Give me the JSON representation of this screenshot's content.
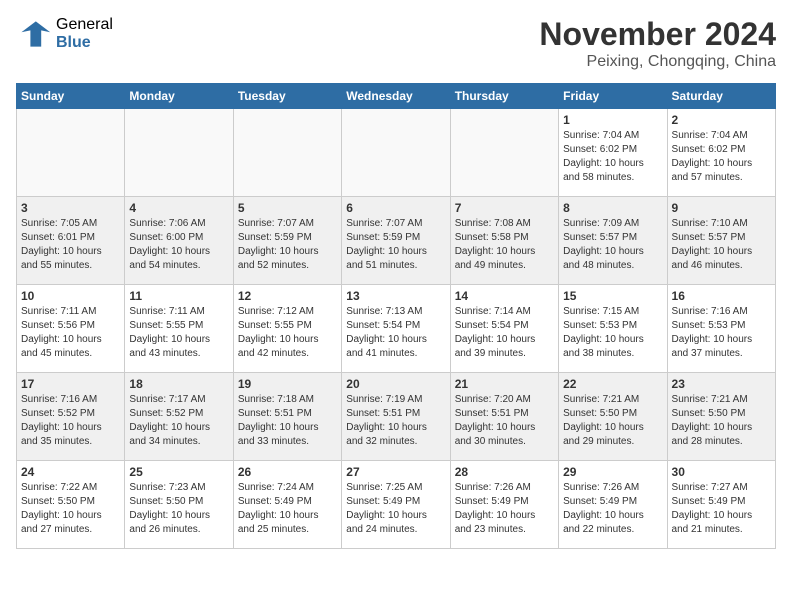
{
  "header": {
    "logo_general": "General",
    "logo_blue": "Blue",
    "month_title": "November 2024",
    "location": "Peixing, Chongqing, China"
  },
  "weekdays": [
    "Sunday",
    "Monday",
    "Tuesday",
    "Wednesday",
    "Thursday",
    "Friday",
    "Saturday"
  ],
  "weeks": [
    [
      {
        "day": "",
        "info": ""
      },
      {
        "day": "",
        "info": ""
      },
      {
        "day": "",
        "info": ""
      },
      {
        "day": "",
        "info": ""
      },
      {
        "day": "",
        "info": ""
      },
      {
        "day": "1",
        "info": "Sunrise: 7:04 AM\nSunset: 6:02 PM\nDaylight: 10 hours and 58 minutes."
      },
      {
        "day": "2",
        "info": "Sunrise: 7:04 AM\nSunset: 6:02 PM\nDaylight: 10 hours and 57 minutes."
      }
    ],
    [
      {
        "day": "3",
        "info": "Sunrise: 7:05 AM\nSunset: 6:01 PM\nDaylight: 10 hours and 55 minutes."
      },
      {
        "day": "4",
        "info": "Sunrise: 7:06 AM\nSunset: 6:00 PM\nDaylight: 10 hours and 54 minutes."
      },
      {
        "day": "5",
        "info": "Sunrise: 7:07 AM\nSunset: 5:59 PM\nDaylight: 10 hours and 52 minutes."
      },
      {
        "day": "6",
        "info": "Sunrise: 7:07 AM\nSunset: 5:59 PM\nDaylight: 10 hours and 51 minutes."
      },
      {
        "day": "7",
        "info": "Sunrise: 7:08 AM\nSunset: 5:58 PM\nDaylight: 10 hours and 49 minutes."
      },
      {
        "day": "8",
        "info": "Sunrise: 7:09 AM\nSunset: 5:57 PM\nDaylight: 10 hours and 48 minutes."
      },
      {
        "day": "9",
        "info": "Sunrise: 7:10 AM\nSunset: 5:57 PM\nDaylight: 10 hours and 46 minutes."
      }
    ],
    [
      {
        "day": "10",
        "info": "Sunrise: 7:11 AM\nSunset: 5:56 PM\nDaylight: 10 hours and 45 minutes."
      },
      {
        "day": "11",
        "info": "Sunrise: 7:11 AM\nSunset: 5:55 PM\nDaylight: 10 hours and 43 minutes."
      },
      {
        "day": "12",
        "info": "Sunrise: 7:12 AM\nSunset: 5:55 PM\nDaylight: 10 hours and 42 minutes."
      },
      {
        "day": "13",
        "info": "Sunrise: 7:13 AM\nSunset: 5:54 PM\nDaylight: 10 hours and 41 minutes."
      },
      {
        "day": "14",
        "info": "Sunrise: 7:14 AM\nSunset: 5:54 PM\nDaylight: 10 hours and 39 minutes."
      },
      {
        "day": "15",
        "info": "Sunrise: 7:15 AM\nSunset: 5:53 PM\nDaylight: 10 hours and 38 minutes."
      },
      {
        "day": "16",
        "info": "Sunrise: 7:16 AM\nSunset: 5:53 PM\nDaylight: 10 hours and 37 minutes."
      }
    ],
    [
      {
        "day": "17",
        "info": "Sunrise: 7:16 AM\nSunset: 5:52 PM\nDaylight: 10 hours and 35 minutes."
      },
      {
        "day": "18",
        "info": "Sunrise: 7:17 AM\nSunset: 5:52 PM\nDaylight: 10 hours and 34 minutes."
      },
      {
        "day": "19",
        "info": "Sunrise: 7:18 AM\nSunset: 5:51 PM\nDaylight: 10 hours and 33 minutes."
      },
      {
        "day": "20",
        "info": "Sunrise: 7:19 AM\nSunset: 5:51 PM\nDaylight: 10 hours and 32 minutes."
      },
      {
        "day": "21",
        "info": "Sunrise: 7:20 AM\nSunset: 5:51 PM\nDaylight: 10 hours and 30 minutes."
      },
      {
        "day": "22",
        "info": "Sunrise: 7:21 AM\nSunset: 5:50 PM\nDaylight: 10 hours and 29 minutes."
      },
      {
        "day": "23",
        "info": "Sunrise: 7:21 AM\nSunset: 5:50 PM\nDaylight: 10 hours and 28 minutes."
      }
    ],
    [
      {
        "day": "24",
        "info": "Sunrise: 7:22 AM\nSunset: 5:50 PM\nDaylight: 10 hours and 27 minutes."
      },
      {
        "day": "25",
        "info": "Sunrise: 7:23 AM\nSunset: 5:50 PM\nDaylight: 10 hours and 26 minutes."
      },
      {
        "day": "26",
        "info": "Sunrise: 7:24 AM\nSunset: 5:49 PM\nDaylight: 10 hours and 25 minutes."
      },
      {
        "day": "27",
        "info": "Sunrise: 7:25 AM\nSunset: 5:49 PM\nDaylight: 10 hours and 24 minutes."
      },
      {
        "day": "28",
        "info": "Sunrise: 7:26 AM\nSunset: 5:49 PM\nDaylight: 10 hours and 23 minutes."
      },
      {
        "day": "29",
        "info": "Sunrise: 7:26 AM\nSunset: 5:49 PM\nDaylight: 10 hours and 22 minutes."
      },
      {
        "day": "30",
        "info": "Sunrise: 7:27 AM\nSunset: 5:49 PM\nDaylight: 10 hours and 21 minutes."
      }
    ]
  ]
}
